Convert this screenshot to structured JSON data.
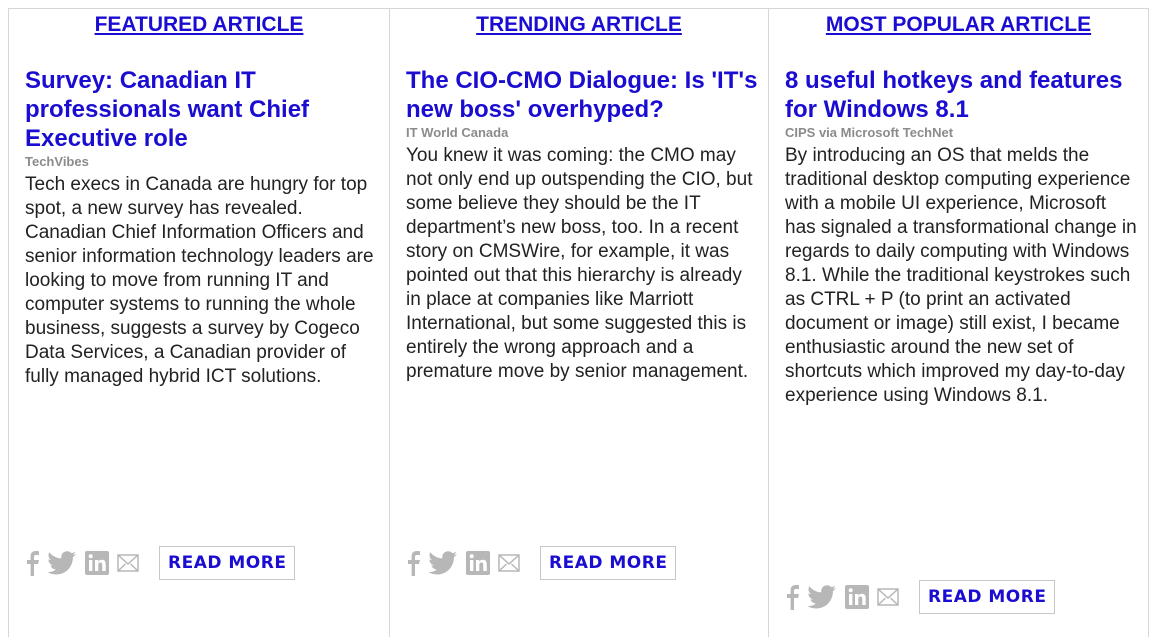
{
  "columns": [
    {
      "heading": "FEATURED ARTICLE",
      "title": "Survey: Canadian IT professionals want Chief Executive role",
      "source": "TechVibes",
      "summary": "Tech execs in Canada are hungry for top spot, a new survey has revealed. Canadian Chief Information Officers and senior information technology leaders are looking to move from running IT and computer systems to running the whole business, suggests a survey by Cogeco Data Services, a Canadian provider of fully managed hybrid ICT solutions.",
      "read_more": "READ MORE"
    },
    {
      "heading": "TRENDING ARTICLE",
      "title": "The CIO-CMO Dialogue: Is 'IT's new boss' overhyped?",
      "source": "IT World Canada",
      "summary": "You knew it was coming: the CMO may not only end up outspending the CIO, but some believe they should be the IT department’s new boss, too. In a recent story on CMSWire, for example, it was pointed out that this hierarchy is already in place at companies like Marriott International, but some suggested this is entirely the wrong approach and a premature move by senior management.",
      "read_more": "READ MORE"
    },
    {
      "heading": "MOST POPULAR ARTICLE",
      "title": "8 useful hotkeys and features for Windows 8.1",
      "source": "CIPS via Microsoft TechNet",
      "summary": "By introducing an OS that melds the traditional desktop computing experience with a mobile UI experience, Microsoft has signaled a transformational change in regards to daily computing with Windows 8.1. While the traditional keystrokes such as CTRL + P (to print an activated document or image) still exist, I became enthusiastic around the new set of shortcuts which improved my day-to-day experience using Windows 8.1.",
      "read_more": "READ MORE"
    }
  ],
  "share_icons": [
    "facebook-icon",
    "twitter-icon",
    "linkedin-icon",
    "email-icon"
  ],
  "colors": {
    "link": "#1a0dd1",
    "source": "#8b8b8b",
    "text": "#222222",
    "icon": "#b7b7b7",
    "border": "#d6d6d6"
  }
}
